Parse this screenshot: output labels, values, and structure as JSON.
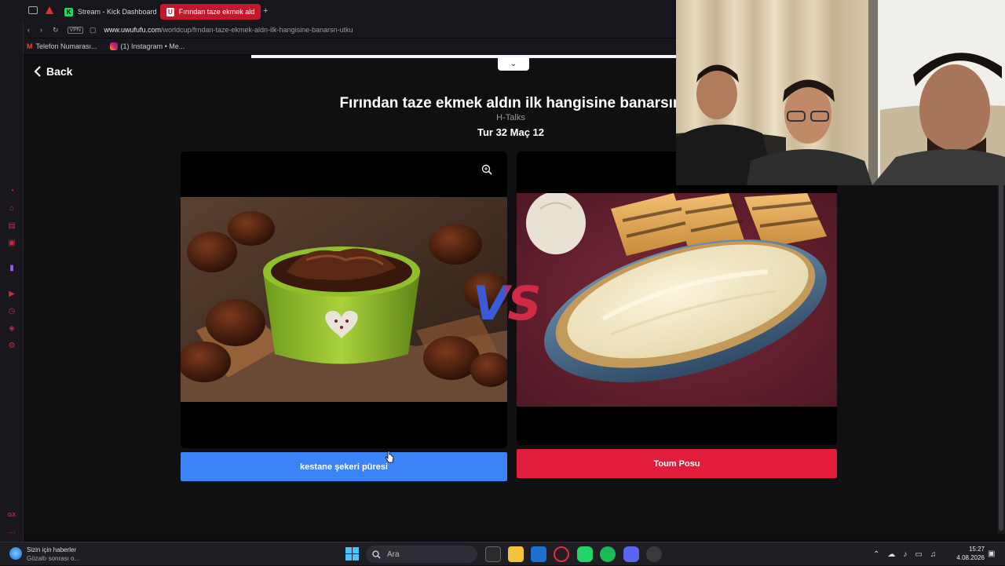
{
  "browser": {
    "tabs": [
      {
        "label": "Stream - Kick Dashboard",
        "favicon": "K"
      },
      {
        "label": "Fırından taze ekmek aldın i",
        "favicon": "U"
      }
    ],
    "vpn_label": "VPN",
    "url_host": "www.uwufufu.com",
    "url_path": "/worldcup/frndan-taze-ekmek-aldn-ilk-hangisine-banarsn-utku",
    "bookmarks": [
      {
        "label": "Telefon Numarası..."
      },
      {
        "label": "(1) Instagram • Me..."
      }
    ],
    "sidebar_badge": "GX"
  },
  "page": {
    "back_label": "Back",
    "title": "Fırından taze ekmek aldın ilk hangisine banarsın",
    "subtitle": "H-Talks",
    "round": "Tur 32 Maç 12",
    "vs": "VS",
    "left_choice": {
      "label": "kestane şekeri püresi",
      "color": "#3b83f6"
    },
    "right_choice": {
      "label": "Toum Posu",
      "color": "#e11d3a"
    }
  },
  "taskbar": {
    "news_title": "Sizin için haberler",
    "news_sub": "Gözaltı sonrası o...",
    "search_placeholder": "Ara",
    "time": "15:27",
    "date": "4.08.2026"
  }
}
